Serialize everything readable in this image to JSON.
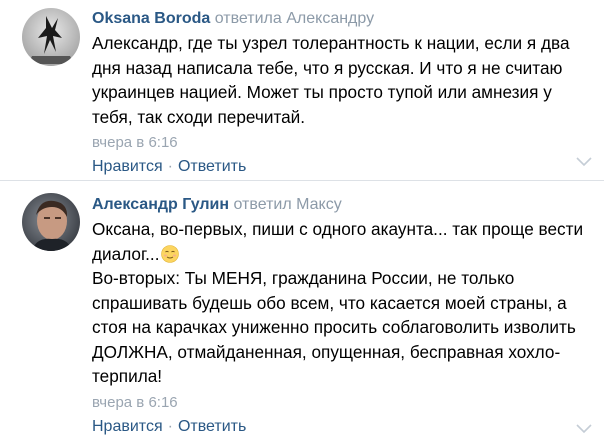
{
  "comments": [
    {
      "author": "Oksana Boroda",
      "reply_verb": "ответила",
      "reply_target": "Александру",
      "text": [
        "Александр, где ты узрел толерантность к нации, если я два дня назад написала тебе, что я русская. И что я не считаю украинцев нацией. Может ты просто тупой или амнезия у тебя, так сходи перечитай."
      ],
      "date": "вчера в 6:16",
      "like_label": "Нравится",
      "reply_label": "Ответить",
      "separator": "·"
    },
    {
      "author": "Александр Гулин",
      "reply_verb": "ответил",
      "reply_target": "Максу",
      "text": [
        "Оксана, во-первых, пиши с одного акаунта... так проще вести диалог...",
        "Во-вторых: Ты МЕНЯ, гражданина России, не только спрашивать будешь обо всем, что касается моей страны, а стоя на карачках униженно просить соблаговолить изволить ДОЛЖНА, отмайданенная, опущенная, бесправная хохло-терпила!"
      ],
      "date": "вчера в 6:16",
      "like_label": "Нравится",
      "reply_label": "Ответить",
      "separator": "·",
      "emoji": "relieved-face-emoji"
    }
  ],
  "colors": {
    "author": "#2a5885",
    "meta": "#8c9aa8",
    "action": "#2a5885",
    "divider": "#dde1e6"
  }
}
